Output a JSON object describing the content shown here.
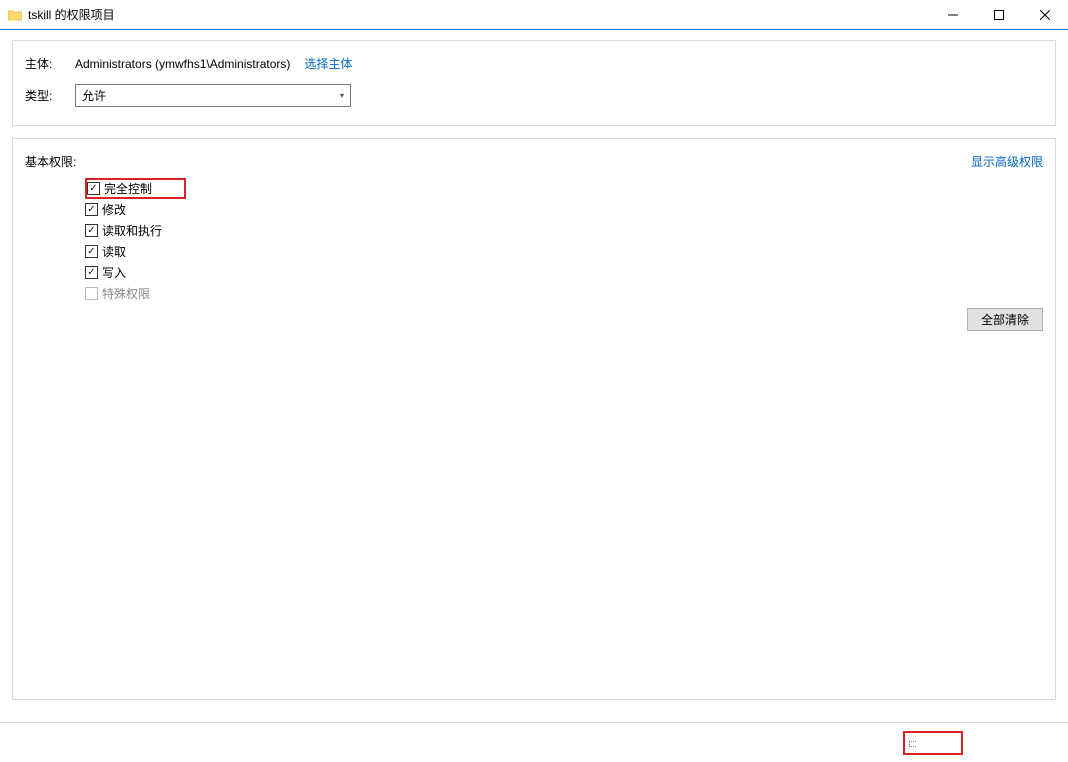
{
  "window": {
    "title": "tskill 的权限项目"
  },
  "principal": {
    "label": "主体:",
    "value": "Administrators (ymwfhs1\\Administrators)",
    "select_link": "选择主体"
  },
  "type": {
    "label": "类型:",
    "selected": "允许"
  },
  "permissions": {
    "section_label": "基本权限:",
    "show_advanced": "显示高级权限",
    "items": [
      {
        "label": "完全控制",
        "checked": true,
        "disabled": false,
        "highlight": true
      },
      {
        "label": "修改",
        "checked": true,
        "disabled": false,
        "highlight": false
      },
      {
        "label": "读取和执行",
        "checked": true,
        "disabled": false,
        "highlight": false
      },
      {
        "label": "读取",
        "checked": true,
        "disabled": false,
        "highlight": false
      },
      {
        "label": "写入",
        "checked": true,
        "disabled": false,
        "highlight": false
      },
      {
        "label": "特殊权限",
        "checked": false,
        "disabled": true,
        "highlight": false
      }
    ],
    "clear_all": "全部清除"
  }
}
